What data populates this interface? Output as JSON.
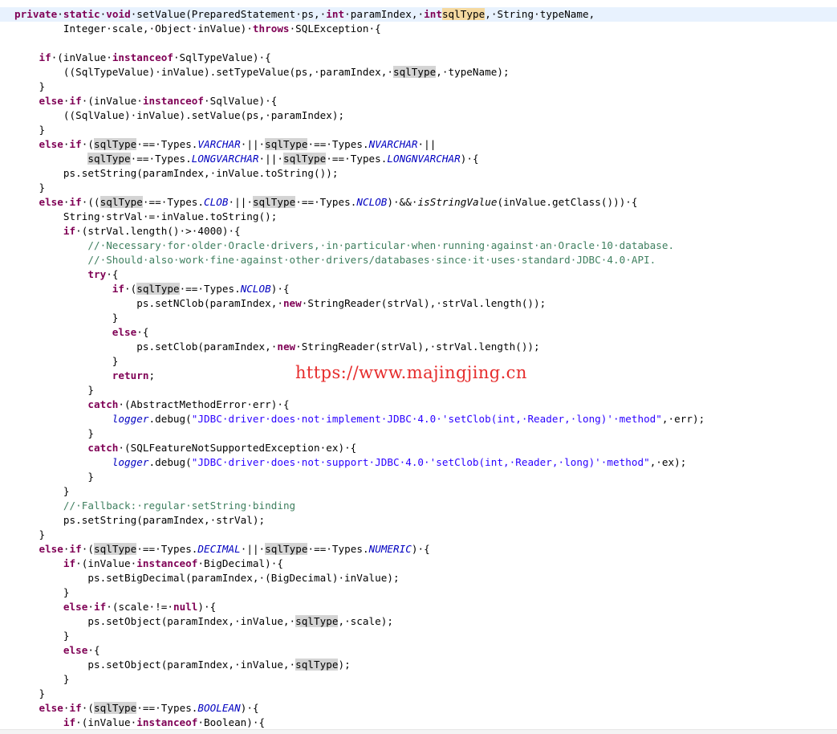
{
  "editor": {
    "lines": [
      [
        [
          "kw",
          "private"
        ],
        [
          "",
          "·"
        ],
        [
          "kw",
          "static"
        ],
        [
          "",
          "·"
        ],
        [
          "kw",
          "void"
        ],
        [
          "",
          "·setValue(PreparedStatement·ps,·"
        ],
        [
          "kw",
          "int"
        ],
        [
          "",
          "·paramIndex,·"
        ],
        [
          "kw",
          "int"
        ],
        [
          "",
          ""
        ],
        [
          "occ-write",
          "sqlType"
        ],
        [
          "",
          ",·String·typeName,"
        ]
      ],
      [
        [
          "",
          "        Integer·scale,·Object·inValue)·"
        ],
        [
          "kw",
          "throws"
        ],
        [
          "",
          "·SQLException·{"
        ]
      ],
      [],
      [
        [
          "",
          "    "
        ],
        [
          "kw",
          "if"
        ],
        [
          "",
          "·(inValue·"
        ],
        [
          "kw",
          "instanceof"
        ],
        [
          "",
          "·SqlTypeValue)·{"
        ]
      ],
      [
        [
          "",
          "        ((SqlTypeValue)·inValue).setTypeValue(ps,·paramIndex,·"
        ],
        [
          "occ",
          "sqlType"
        ],
        [
          "",
          ",·typeName);"
        ]
      ],
      [
        [
          "",
          "    }"
        ]
      ],
      [
        [
          "",
          "    "
        ],
        [
          "kw",
          "else"
        ],
        [
          "",
          "·"
        ],
        [
          "kw",
          "if"
        ],
        [
          "",
          "·(inValue·"
        ],
        [
          "kw",
          "instanceof"
        ],
        [
          "",
          "·SqlValue)·{"
        ]
      ],
      [
        [
          "",
          "        ((SqlValue)·inValue).setValue(ps,·paramIndex);"
        ]
      ],
      [
        [
          "",
          "    }"
        ]
      ],
      [
        [
          "",
          "    "
        ],
        [
          "kw",
          "else"
        ],
        [
          "",
          "·"
        ],
        [
          "kw",
          "if"
        ],
        [
          "",
          "·("
        ],
        [
          "occ",
          "sqlType"
        ],
        [
          "",
          "·==·Types."
        ],
        [
          "field",
          "VARCHAR"
        ],
        [
          "",
          "·||·"
        ],
        [
          "occ",
          "sqlType"
        ],
        [
          "",
          "·==·Types."
        ],
        [
          "field",
          "NVARCHAR"
        ],
        [
          "",
          "·||"
        ]
      ],
      [
        [
          "",
          "            "
        ],
        [
          "occ",
          "sqlType"
        ],
        [
          "",
          "·==·Types."
        ],
        [
          "field",
          "LONGVARCHAR"
        ],
        [
          "",
          "·||·"
        ],
        [
          "occ",
          "sqlType"
        ],
        [
          "",
          "·==·Types."
        ],
        [
          "field",
          "LONGNVARCHAR"
        ],
        [
          "",
          ")·{"
        ]
      ],
      [
        [
          "",
          "        ps.setString(paramIndex,·inValue.toString());"
        ]
      ],
      [
        [
          "",
          "    }"
        ]
      ],
      [
        [
          "",
          "    "
        ],
        [
          "kw",
          "else"
        ],
        [
          "",
          "·"
        ],
        [
          "kw",
          "if"
        ],
        [
          "",
          "·(("
        ],
        [
          "occ",
          "sqlType"
        ],
        [
          "",
          "·==·Types."
        ],
        [
          "field",
          "CLOB"
        ],
        [
          "",
          "·||·"
        ],
        [
          "occ",
          "sqlType"
        ],
        [
          "",
          "·==·Types."
        ],
        [
          "field",
          "NCLOB"
        ],
        [
          "",
          ")·&&·"
        ],
        [
          "smethod",
          "isStringValue"
        ],
        [
          "",
          "(inValue.getClass()))·{"
        ]
      ],
      [
        [
          "",
          "        String·strVal·=·inValue.toString();"
        ]
      ],
      [
        [
          "",
          "        "
        ],
        [
          "kw",
          "if"
        ],
        [
          "",
          "·(strVal.length()·>·4000)·{"
        ]
      ],
      [
        [
          "",
          "            "
        ],
        [
          "cmt",
          "//·Necessary·for·older·Oracle·drivers,·in·particular·when·running·against·an·Oracle·10·database."
        ]
      ],
      [
        [
          "",
          "            "
        ],
        [
          "cmt",
          "//·Should·also·work·fine·against·other·drivers/databases·since·it·uses·standard·JDBC·4.0·API."
        ]
      ],
      [
        [
          "",
          "            "
        ],
        [
          "kw",
          "try"
        ],
        [
          "",
          "·{"
        ]
      ],
      [
        [
          "",
          "                "
        ],
        [
          "kw",
          "if"
        ],
        [
          "",
          "·("
        ],
        [
          "occ",
          "sqlType"
        ],
        [
          "",
          "·==·Types."
        ],
        [
          "field",
          "NCLOB"
        ],
        [
          "",
          ")·{"
        ]
      ],
      [
        [
          "",
          "                    ps.setNClob(paramIndex,·"
        ],
        [
          "kw",
          "new"
        ],
        [
          "",
          "·StringReader(strVal),·strVal.length());"
        ]
      ],
      [
        [
          "",
          "                }"
        ]
      ],
      [
        [
          "",
          "                "
        ],
        [
          "kw",
          "else"
        ],
        [
          "",
          "·{"
        ]
      ],
      [
        [
          "",
          "                    ps.setClob(paramIndex,·"
        ],
        [
          "kw",
          "new"
        ],
        [
          "",
          "·StringReader(strVal),·strVal.length());"
        ]
      ],
      [
        [
          "",
          "                }"
        ]
      ],
      [
        [
          "",
          "                "
        ],
        [
          "kw",
          "return"
        ],
        [
          "",
          ";"
        ]
      ],
      [
        [
          "",
          "            }"
        ]
      ],
      [
        [
          "",
          "            "
        ],
        [
          "kw",
          "catch"
        ],
        [
          "",
          "·(AbstractMethodError·err)·{"
        ]
      ],
      [
        [
          "",
          "                "
        ],
        [
          "field",
          "logger"
        ],
        [
          "",
          ".debug("
        ],
        [
          "str",
          "\"JDBC·driver·does·not·implement·JDBC·4.0·'setClob(int,·Reader,·long)'·method\""
        ],
        [
          "",
          ",·err);"
        ]
      ],
      [
        [
          "",
          "            }"
        ]
      ],
      [
        [
          "",
          "            "
        ],
        [
          "kw",
          "catch"
        ],
        [
          "",
          "·(SQLFeatureNotSupportedException·ex)·{"
        ]
      ],
      [
        [
          "",
          "                "
        ],
        [
          "field",
          "logger"
        ],
        [
          "",
          ".debug("
        ],
        [
          "str",
          "\"JDBC·driver·does·not·support·JDBC·4.0·'setClob(int,·Reader,·long)'·method\""
        ],
        [
          "",
          ",·ex);"
        ]
      ],
      [
        [
          "",
          "            }"
        ]
      ],
      [
        [
          "",
          "        }"
        ]
      ],
      [
        [
          "",
          "        "
        ],
        [
          "cmt",
          "//·Fallback:·regular·setString·binding"
        ]
      ],
      [
        [
          "",
          "        ps.setString(paramIndex,·strVal);"
        ]
      ],
      [
        [
          "",
          "    }"
        ]
      ],
      [
        [
          "",
          "    "
        ],
        [
          "kw",
          "else"
        ],
        [
          "",
          "·"
        ],
        [
          "kw",
          "if"
        ],
        [
          "",
          "·("
        ],
        [
          "occ",
          "sqlType"
        ],
        [
          "",
          "·==·Types."
        ],
        [
          "field",
          "DECIMAL"
        ],
        [
          "",
          "·||·"
        ],
        [
          "occ",
          "sqlType"
        ],
        [
          "",
          "·==·Types."
        ],
        [
          "field",
          "NUMERIC"
        ],
        [
          "",
          ")·{"
        ]
      ],
      [
        [
          "",
          "        "
        ],
        [
          "kw",
          "if"
        ],
        [
          "",
          "·(inValue·"
        ],
        [
          "kw",
          "instanceof"
        ],
        [
          "",
          "·BigDecimal)·{"
        ]
      ],
      [
        [
          "",
          "            ps.setBigDecimal(paramIndex,·(BigDecimal)·inValue);"
        ]
      ],
      [
        [
          "",
          "        }"
        ]
      ],
      [
        [
          "",
          "        "
        ],
        [
          "kw",
          "else"
        ],
        [
          "",
          "·"
        ],
        [
          "kw",
          "if"
        ],
        [
          "",
          "·(scale·!=·"
        ],
        [
          "kw",
          "null"
        ],
        [
          "",
          ")·{"
        ]
      ],
      [
        [
          "",
          "            ps.setObject(paramIndex,·inValue,·"
        ],
        [
          "occ",
          "sqlType"
        ],
        [
          "",
          ",·scale);"
        ]
      ],
      [
        [
          "",
          "        }"
        ]
      ],
      [
        [
          "",
          "        "
        ],
        [
          "kw",
          "else"
        ],
        [
          "",
          "·{"
        ]
      ],
      [
        [
          "",
          "            ps.setObject(paramIndex,·inValue,·"
        ],
        [
          "occ",
          "sqlType"
        ],
        [
          "",
          ");"
        ]
      ],
      [
        [
          "",
          "        }"
        ]
      ],
      [
        [
          "",
          "    }"
        ]
      ],
      [
        [
          "",
          "    "
        ],
        [
          "kw",
          "else"
        ],
        [
          "",
          "·"
        ],
        [
          "kw",
          "if"
        ],
        [
          "",
          "·("
        ],
        [
          "occ",
          "sqlType"
        ],
        [
          "",
          "·==·Types."
        ],
        [
          "field",
          "BOOLEAN"
        ],
        [
          "",
          ")·{"
        ]
      ],
      [
        [
          "",
          "        "
        ],
        [
          "kw",
          "if"
        ],
        [
          "",
          "·(inValue·"
        ],
        [
          "kw",
          "instanceof"
        ],
        [
          "",
          "·Boolean)·{"
        ]
      ]
    ]
  },
  "watermark": "https://www.majingjing.cn",
  "colors": {
    "keyword": "#7f0055",
    "static_field": "#0000c0",
    "string": "#2a00ff",
    "comment": "#3f7f5f",
    "occurrence_highlight": "#d4d4d4",
    "write_occurrence_highlight": "#f5d9a0",
    "current_line": "#e8f2fe",
    "watermark": "#e62c2c"
  }
}
